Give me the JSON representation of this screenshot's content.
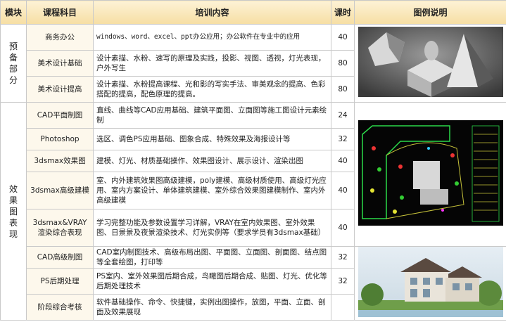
{
  "header": {
    "col1": "模块",
    "col2": "课程科目",
    "col3": "培训内容",
    "col4": "课时",
    "col5": "图例说明"
  },
  "groups": [
    {
      "name": "预备部分"
    },
    {
      "name": "效果图表现"
    }
  ],
  "rows": [
    {
      "course": "商务办公",
      "content": "windows、word、excel、ppt办公应用；办公软件在专业中的应用",
      "hours": "40"
    },
    {
      "course": "美术设计基础",
      "content": "设计素描、水粉、速写的原理及实践，投影、视图、透视，灯光表现，户外写生",
      "hours": "80"
    },
    {
      "course": "美术设计提高",
      "content": "设计素描、水粉提高课程、光和影的写实手法、审美观念的提高、色彩搭配的提高，配色原理的提高。",
      "hours": "80"
    },
    {
      "course": "CAD平面制图",
      "content": "直线、曲线等CAD应用基础、建筑平面图、立面图等施工图设计元素绘制",
      "hours": "24"
    },
    {
      "course": "Photoshop",
      "content": "选区、调色PS应用基础、图象合成、特殊效果及海报设计等",
      "hours": "32"
    },
    {
      "course": "3dsmax效果图",
      "content": "建模、灯光、材质基础操作、效果图设计、展示设计、渲染出图",
      "hours": "40"
    },
    {
      "course": "3dsmax高级建模",
      "content": "室、内外建筑效果图高级建模，poly建模、高级材质使用、高级灯光应用、室内方案设计、单体建筑建模、室外综合效果图建模制作、室内外高级建模",
      "hours": "40"
    },
    {
      "course": "3dsmax&VRAY渲染综合表现",
      "content": "学习完整功能及参数设置学习详解，VRAY在室内效果图、室外效果图、日景景及夜景渲染技术、灯光实例等（要求学员有3dsmax基础）",
      "hours": "40"
    },
    {
      "course": "CAD高级制图",
      "content": "CAD室内制图技术、高级布局出图、平面图、立面图、剖面图、结点图等全套绘图，打印等",
      "hours": "32"
    },
    {
      "course": "PS后期处理",
      "content": "PS室内、室外效果图后期合成，鸟瞰图后期合成、贴图、灯光、优化等后期处理技术",
      "hours": "32"
    },
    {
      "course": "阶段综合考核",
      "content": "软件基础操作、命令、快捷键，实例出图操作，放图，平面、立面、剖面及效果展现",
      "hours": ""
    }
  ]
}
